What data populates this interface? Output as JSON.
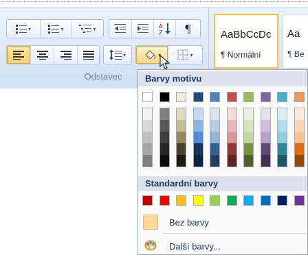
{
  "ribbon": {
    "group_label": "Odstavec",
    "styles": [
      {
        "sample": "AaBbCcDc",
        "name": "¶ Normální",
        "selected": true
      },
      {
        "sample": "Aa",
        "name": "¶ Be",
        "selected": false
      }
    ]
  },
  "menu": {
    "theme_header": "Barvy motivu",
    "standard_header": "Standardní barvy",
    "theme_colors": [
      {
        "base": "#ffffff",
        "shades": [
          "#f2f2f2",
          "#d8d8d8",
          "#bfbfbf",
          "#a5a5a5",
          "#7f7f7f"
        ]
      },
      {
        "base": "#000000",
        "shades": [
          "#7f7f7f",
          "#595959",
          "#3f3f3f",
          "#262626",
          "#0c0c0c"
        ]
      },
      {
        "base": "#eeece1",
        "shades": [
          "#ddd9c3",
          "#c4bd97",
          "#938953",
          "#494429",
          "#1d1b10"
        ]
      },
      {
        "base": "#1f497d",
        "shades": [
          "#c6d9f0",
          "#8db3e2",
          "#548dd4",
          "#17365d",
          "#0f243e"
        ]
      },
      {
        "base": "#4f81bd",
        "shades": [
          "#dbe5f1",
          "#b8cce4",
          "#95b3d7",
          "#366092",
          "#244061"
        ]
      },
      {
        "base": "#c0504d",
        "shades": [
          "#f2dcdb",
          "#e5b9b7",
          "#d99694",
          "#953734",
          "#632423"
        ]
      },
      {
        "base": "#9bbb59",
        "shades": [
          "#ebf1dd",
          "#d7e3bc",
          "#c3d69b",
          "#76923c",
          "#4f6128"
        ]
      },
      {
        "base": "#8064a2",
        "shades": [
          "#e5e0ec",
          "#ccc1d9",
          "#b2a2c7",
          "#5f497a",
          "#3f3151"
        ]
      },
      {
        "base": "#4bacc6",
        "shades": [
          "#dbeef3",
          "#b7dde8",
          "#92cddc",
          "#31859b",
          "#205867"
        ]
      },
      {
        "base": "#f79646",
        "shades": [
          "#fdeada",
          "#fbd5b5",
          "#fac08f",
          "#e36c09",
          "#974806"
        ]
      }
    ],
    "standard_colors": [
      "#c00000",
      "#ff0000",
      "#ffc000",
      "#ffff00",
      "#92d050",
      "#00b050",
      "#00b0f0",
      "#0070c0",
      "#002060",
      "#7030a0"
    ],
    "no_color_label": "Bez barvy",
    "more_colors_label": "Další barvy...",
    "no_color_swatch": "#fdd99b"
  },
  "icons": {
    "bullets": "bullets-icon",
    "numbering": "numbering-icon",
    "multilevel": "multilevel-list-icon",
    "decrease_indent": "decrease-indent-icon",
    "increase_indent": "increase-indent-icon",
    "sort": "sort-icon",
    "pilcrow": "show-formatting-marks-icon",
    "align_left": "align-left-icon",
    "align_center": "align-center-icon",
    "align_right": "align-right-icon",
    "justify": "justify-icon",
    "line_spacing": "line-spacing-icon",
    "shading": "shading-bucket-icon",
    "borders": "borders-icon",
    "palette": "palette-icon"
  }
}
